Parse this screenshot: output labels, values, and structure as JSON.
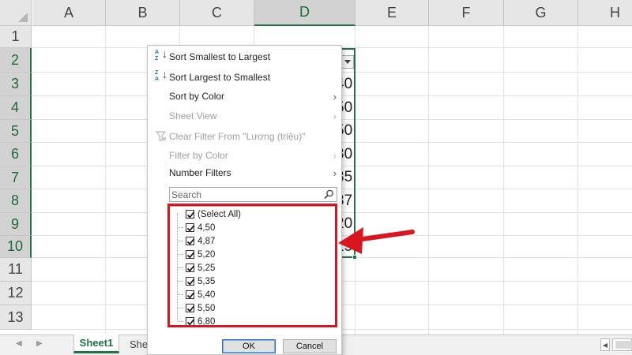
{
  "sheet": {
    "columns": [
      "A",
      "B",
      "C",
      "D",
      "E",
      "F",
      "G",
      "H"
    ],
    "rows": [
      "1",
      "2",
      "3",
      "4",
      "5",
      "6",
      "7",
      "8",
      "9",
      "10",
      "11",
      "12",
      "13"
    ],
    "selected_column": "D",
    "visible_cell_fragments": [
      "40",
      "50",
      "50",
      "30",
      "35",
      "37",
      "20",
      "25"
    ]
  },
  "tabs": {
    "sheet1": "Sheet1",
    "sheet2_partial": "Shee"
  },
  "filter_menu": {
    "sort_asc": "Sort Smallest to Largest",
    "sort_desc": "Sort Largest to Smallest",
    "sort_by_color": "Sort by Color",
    "sheet_view": "Sheet View",
    "clear_filter": "Clear Filter From \"Lương (triệu)\"",
    "filter_by_color": "Filter by Color",
    "number_filters": "Number Filters",
    "search_placeholder": "Search",
    "list": [
      {
        "label": "(Select All)",
        "checked": true
      },
      {
        "label": "4,50",
        "checked": true
      },
      {
        "label": "4,87",
        "checked": true
      },
      {
        "label": "5,20",
        "checked": true
      },
      {
        "label": "5,25",
        "checked": true
      },
      {
        "label": "5,35",
        "checked": true
      },
      {
        "label": "5,40",
        "checked": true
      },
      {
        "label": "5,50",
        "checked": true
      },
      {
        "label": "6,80",
        "checked": true
      }
    ],
    "ok": "OK",
    "cancel": "Cancel"
  },
  "colors": {
    "excel_green": "#217346",
    "highlight_red": "#d9151f"
  },
  "icons": {
    "sort_asc": "sort-ascending-icon",
    "sort_desc": "sort-descending-icon",
    "clear_filter": "clear-filter-icon",
    "search": "search-icon",
    "submenu": "chevron-right-icon"
  }
}
